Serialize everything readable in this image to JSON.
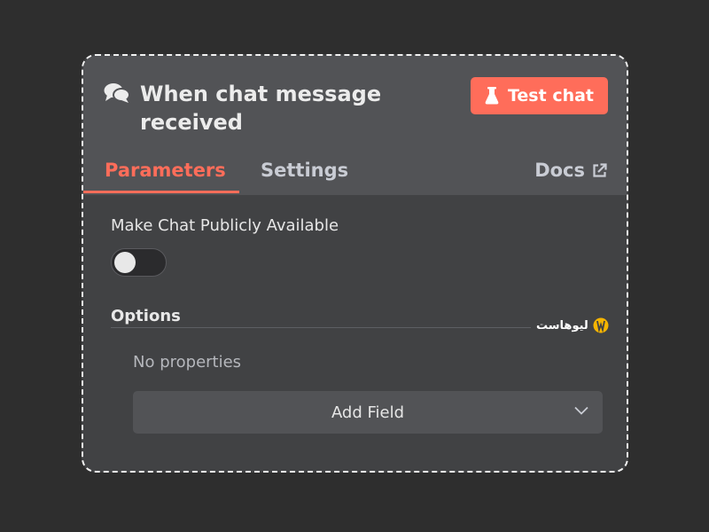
{
  "node": {
    "title": "When chat message received",
    "test_button_label": "Test chat",
    "chat_icon": "chat-bubbles-icon",
    "flask_icon": "flask-icon"
  },
  "tabs": [
    {
      "label": "Parameters",
      "active": true
    },
    {
      "label": "Settings",
      "active": false
    }
  ],
  "docs": {
    "label": "Docs",
    "icon": "external-link-icon"
  },
  "parameters": {
    "public_label": "Make Chat Publicly Available",
    "public_enabled": false,
    "options_label": "Options",
    "no_properties": "No properties",
    "add_field_label": "Add Field"
  },
  "watermark": {
    "text": "لیوهاست"
  },
  "colors": {
    "accent": "#ff6d5a",
    "panel_header": "#525356",
    "panel_body": "#414244",
    "background": "#2e2e2e"
  }
}
